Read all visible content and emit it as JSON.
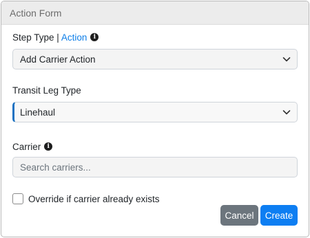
{
  "header": {
    "title": "Action Form"
  },
  "step_type": {
    "label": "Step Type |",
    "link": "Action",
    "value": "Add Carrier Action"
  },
  "transit_leg": {
    "label": "Transit Leg Type",
    "value": "Linehaul"
  },
  "carrier": {
    "label": "Carrier",
    "placeholder": "Search carriers..."
  },
  "override": {
    "label": "Override if carrier already exists",
    "checked": false
  },
  "footer": {
    "cancel_label": "Cancel",
    "create_label": "Create"
  },
  "colors": {
    "primary": "#0d7ef2",
    "secondary": "#6c757d",
    "accent_border": "#1b72c2"
  }
}
